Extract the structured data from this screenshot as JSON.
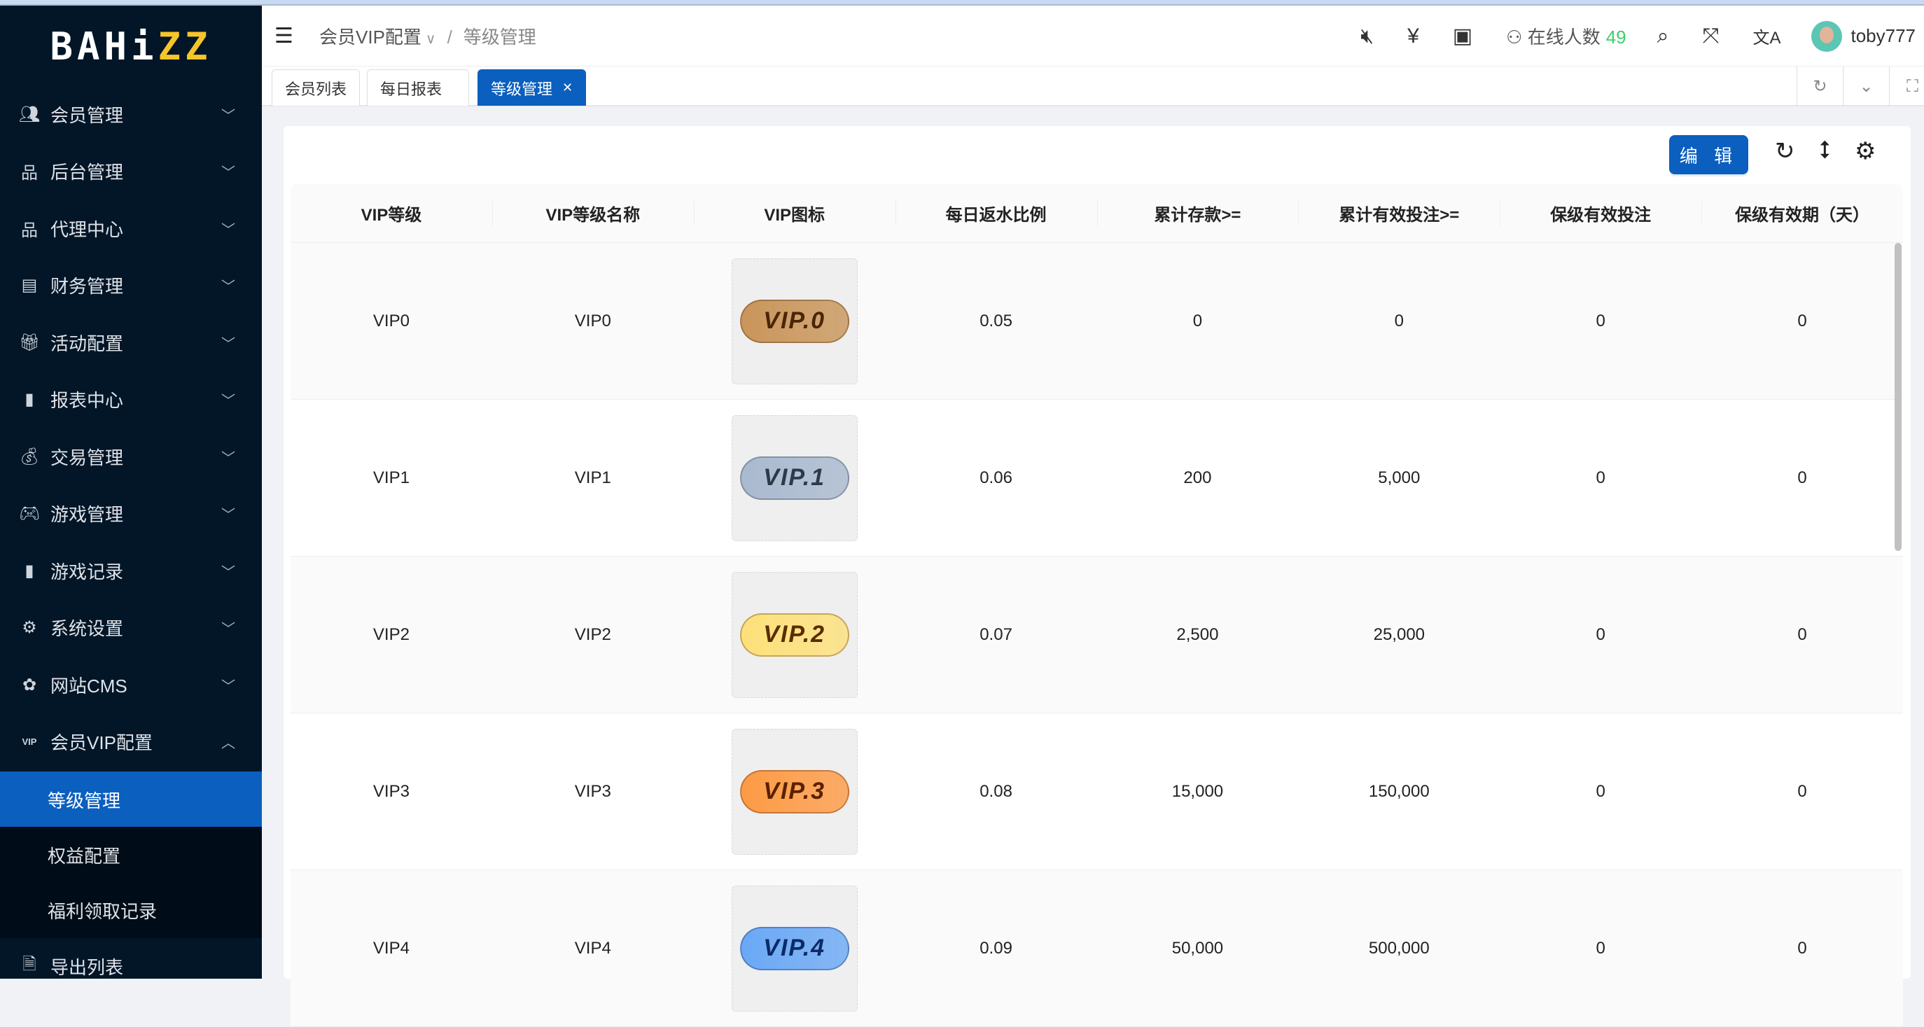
{
  "logo": {
    "white": "BAHi",
    "yellow": "ZZ"
  },
  "sidebar": {
    "items": [
      {
        "label": "会员管理",
        "icon": "users-icon"
      },
      {
        "label": "后台管理",
        "icon": "sitemap-icon"
      },
      {
        "label": "代理中心",
        "icon": "agent-icon"
      },
      {
        "label": "财务管理",
        "icon": "finance-icon"
      },
      {
        "label": "活动配置",
        "icon": "gift-icon"
      },
      {
        "label": "报表中心",
        "icon": "bar-chart-icon"
      },
      {
        "label": "交易管理",
        "icon": "money-bag-icon"
      },
      {
        "label": "游戏管理",
        "icon": "gamepad-icon"
      },
      {
        "label": "游戏记录",
        "icon": "sd-card-icon"
      },
      {
        "label": "系统设置",
        "icon": "gear-icon"
      },
      {
        "label": "网站CMS",
        "icon": "cog-icon"
      },
      {
        "label": "会员VIP配置",
        "icon": "vip-icon"
      }
    ],
    "sub": [
      {
        "label": "等级管理"
      },
      {
        "label": "权益配置"
      },
      {
        "label": "福利领取记录"
      }
    ],
    "export": {
      "label": "导出列表"
    }
  },
  "header": {
    "breadcrumb": [
      "会员VIP配置",
      "等级管理"
    ],
    "online_label": "在线人数",
    "online_count": "49",
    "username": "toby777"
  },
  "tabs": [
    {
      "label": "会员列表"
    },
    {
      "label": "每日报表"
    },
    {
      "label": "等级管理"
    }
  ],
  "toolbar": {
    "edit_label": "编 辑"
  },
  "table": {
    "columns": [
      "VIP等级",
      "VIP等级名称",
      "VIP图标",
      "每日返水比例",
      "累计存款>=",
      "累计有效投注>=",
      "保级有效投注",
      "保级有效期（天）"
    ],
    "rows": [
      {
        "level": "VIP0",
        "name": "VIP0",
        "badge": "VIP.0",
        "rebate": "0.05",
        "deposit": "0",
        "bet": "0",
        "keep_bet": "0",
        "keep_days": "0",
        "color": "#c9955a",
        "text": "#4a2608"
      },
      {
        "level": "VIP1",
        "name": "VIP1",
        "badge": "VIP.1",
        "rebate": "0.06",
        "deposit": "200",
        "bet": "5,000",
        "keep_bet": "0",
        "keep_days": "0",
        "color": "#a9b9cf",
        "text": "#2d3a4a"
      },
      {
        "level": "VIP2",
        "name": "VIP2",
        "badge": "VIP.2",
        "rebate": "0.07",
        "deposit": "2,500",
        "bet": "25,000",
        "keep_bet": "0",
        "keep_days": "0",
        "color": "#fde07a",
        "text": "#5a2d00"
      },
      {
        "level": "VIP3",
        "name": "VIP3",
        "badge": "VIP.3",
        "rebate": "0.08",
        "deposit": "15,000",
        "bet": "150,000",
        "keep_bet": "0",
        "keep_days": "0",
        "color": "#fd9a45",
        "text": "#5a2000"
      },
      {
        "level": "VIP4",
        "name": "VIP4",
        "badge": "VIP.4",
        "rebate": "0.09",
        "deposit": "50,000",
        "bet": "500,000",
        "keep_bet": "0",
        "keep_days": "0",
        "color": "#6aa8f5",
        "text": "#0b2a66"
      }
    ]
  }
}
